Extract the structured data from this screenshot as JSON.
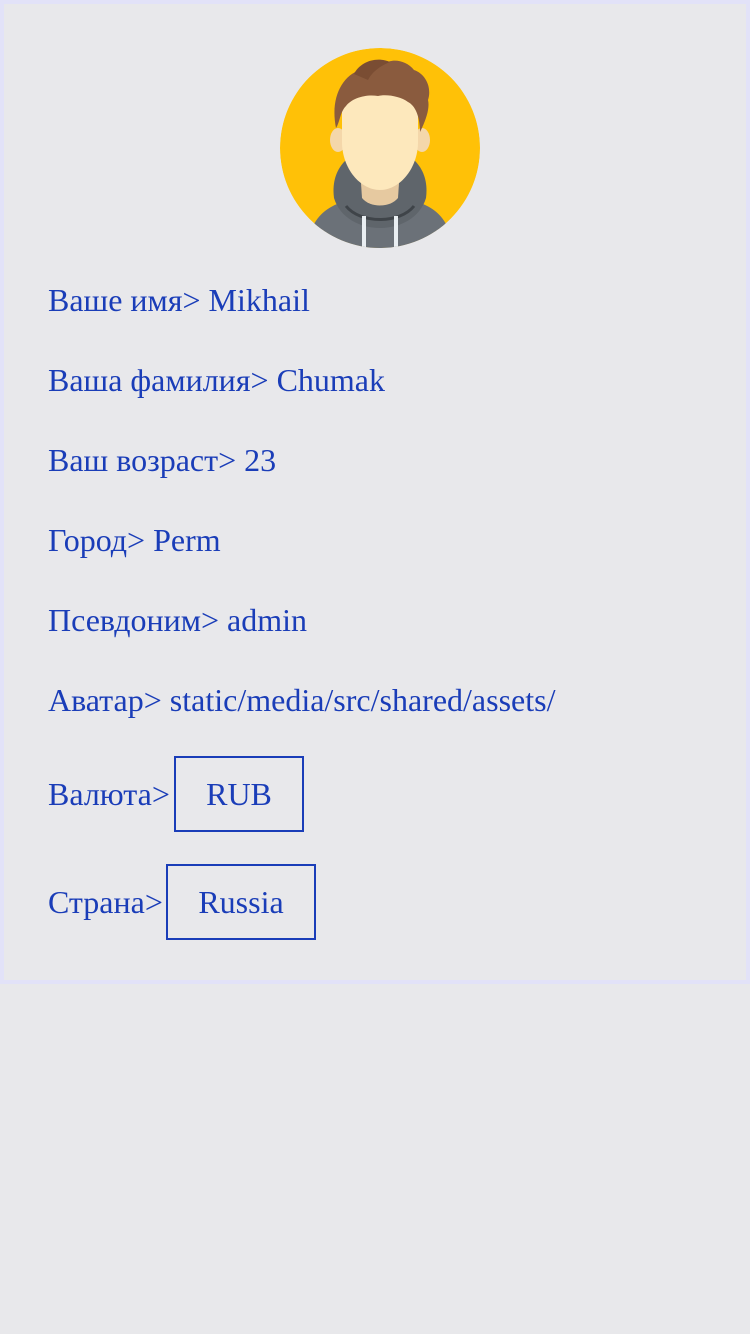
{
  "profile": {
    "avatar_icon": "user-avatar-illustration",
    "fields": [
      {
        "label": "Ваше имя>",
        "value": "Mikhail"
      },
      {
        "label": "Ваша фамилия>",
        "value": "Chumak"
      },
      {
        "label": "Ваш возраст>",
        "value": "23"
      },
      {
        "label": "Город>",
        "value": "Perm"
      },
      {
        "label": "Псевдоним>",
        "value": "admin"
      },
      {
        "label": "Аватар>",
        "value": "static/media/src/shared/assets/"
      }
    ],
    "currency": {
      "label": "Валюта>",
      "value": "RUB"
    },
    "country": {
      "label": "Страна>",
      "value": "Russia"
    }
  },
  "colors": {
    "text": "#1a3db8",
    "background": "#e8e8eb",
    "avatar_bg": "#ffc107"
  }
}
